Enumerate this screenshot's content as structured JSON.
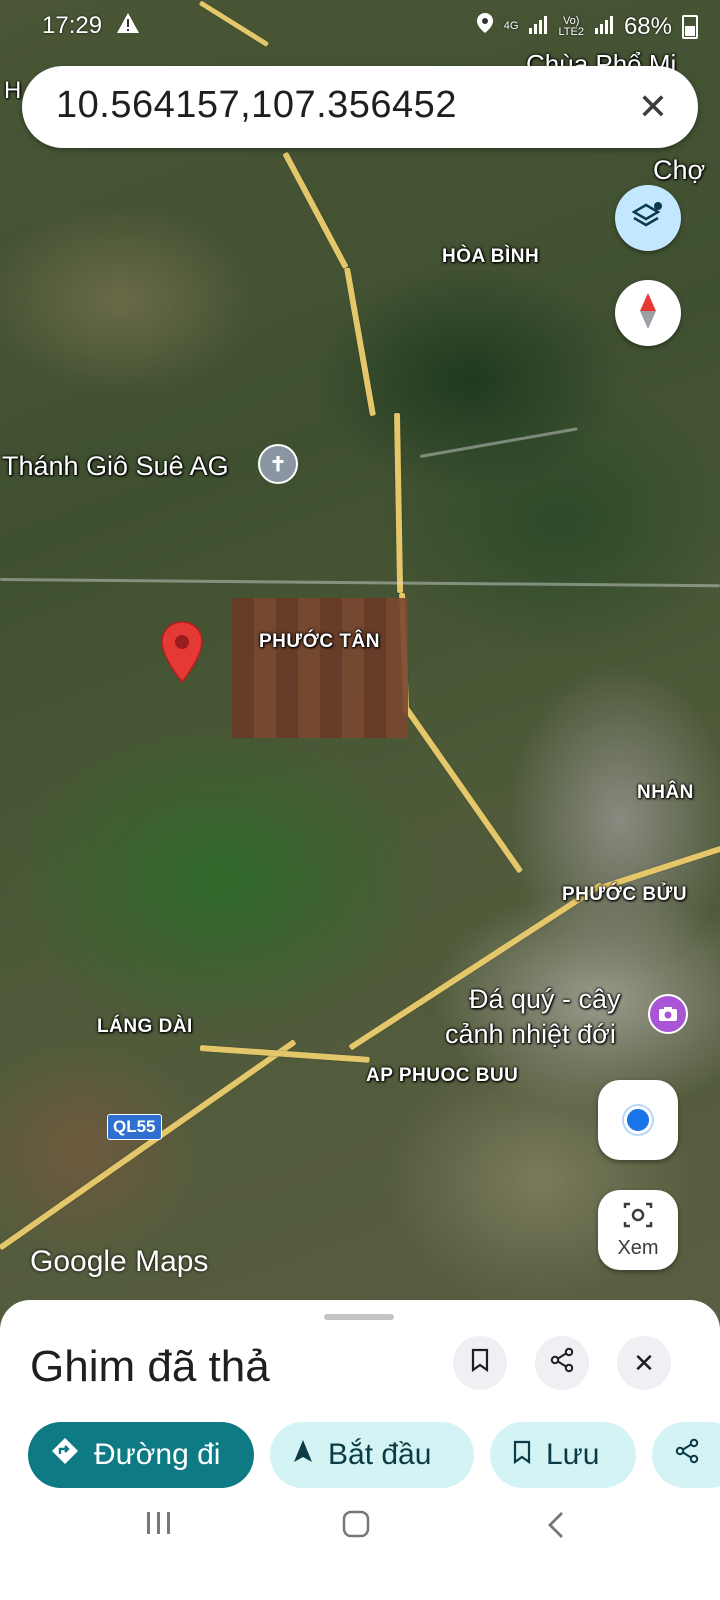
{
  "status_bar": {
    "time": "17:29",
    "warning_icon": "warning-icon",
    "net_4g": "4G",
    "volte_top": "Vo)",
    "volte_bottom": "LTE2",
    "battery": "68%"
  },
  "search": {
    "query": "10.564157,107.356452",
    "close_icon": "close-icon"
  },
  "map": {
    "labels": [
      {
        "id": "hoa-binh",
        "text": "HÒA BÌNH"
      },
      {
        "id": "phuoc-tan",
        "text": "PHƯỚC TÂN"
      },
      {
        "id": "nhan",
        "text": "NHÂN"
      },
      {
        "id": "phuoc-buu",
        "text": "PHƯỚC BỬU"
      },
      {
        "id": "lang-dai",
        "text": "LÁNG DÀI"
      },
      {
        "id": "ap-phuoc-buu",
        "text": "AP PHUOC BUU"
      },
      {
        "id": "cho",
        "text": "Chợ"
      },
      {
        "id": "chua",
        "text": "Chùa Phổ Mi"
      },
      {
        "id": "edge-h",
        "text": "H"
      }
    ],
    "pois": {
      "church": "Thánh Giô Suê AG",
      "gem_line1": "Đá quý - cây",
      "gem_line2": "cảnh nhiệt đới"
    },
    "route": "QL55",
    "watermark": "Google Maps",
    "pin_color": "#e53935"
  },
  "controls": {
    "layers_icon": "layers-icon",
    "compass_icon": "compass-icon",
    "my_location_icon": "my-location-icon",
    "lens_label": "Xem"
  },
  "sheet": {
    "title": "Ghim đã thả",
    "chips": {
      "directions": "Đường đi",
      "start": "Bắt đầu",
      "save": "Lưu"
    },
    "accent": "#0d7a84"
  }
}
